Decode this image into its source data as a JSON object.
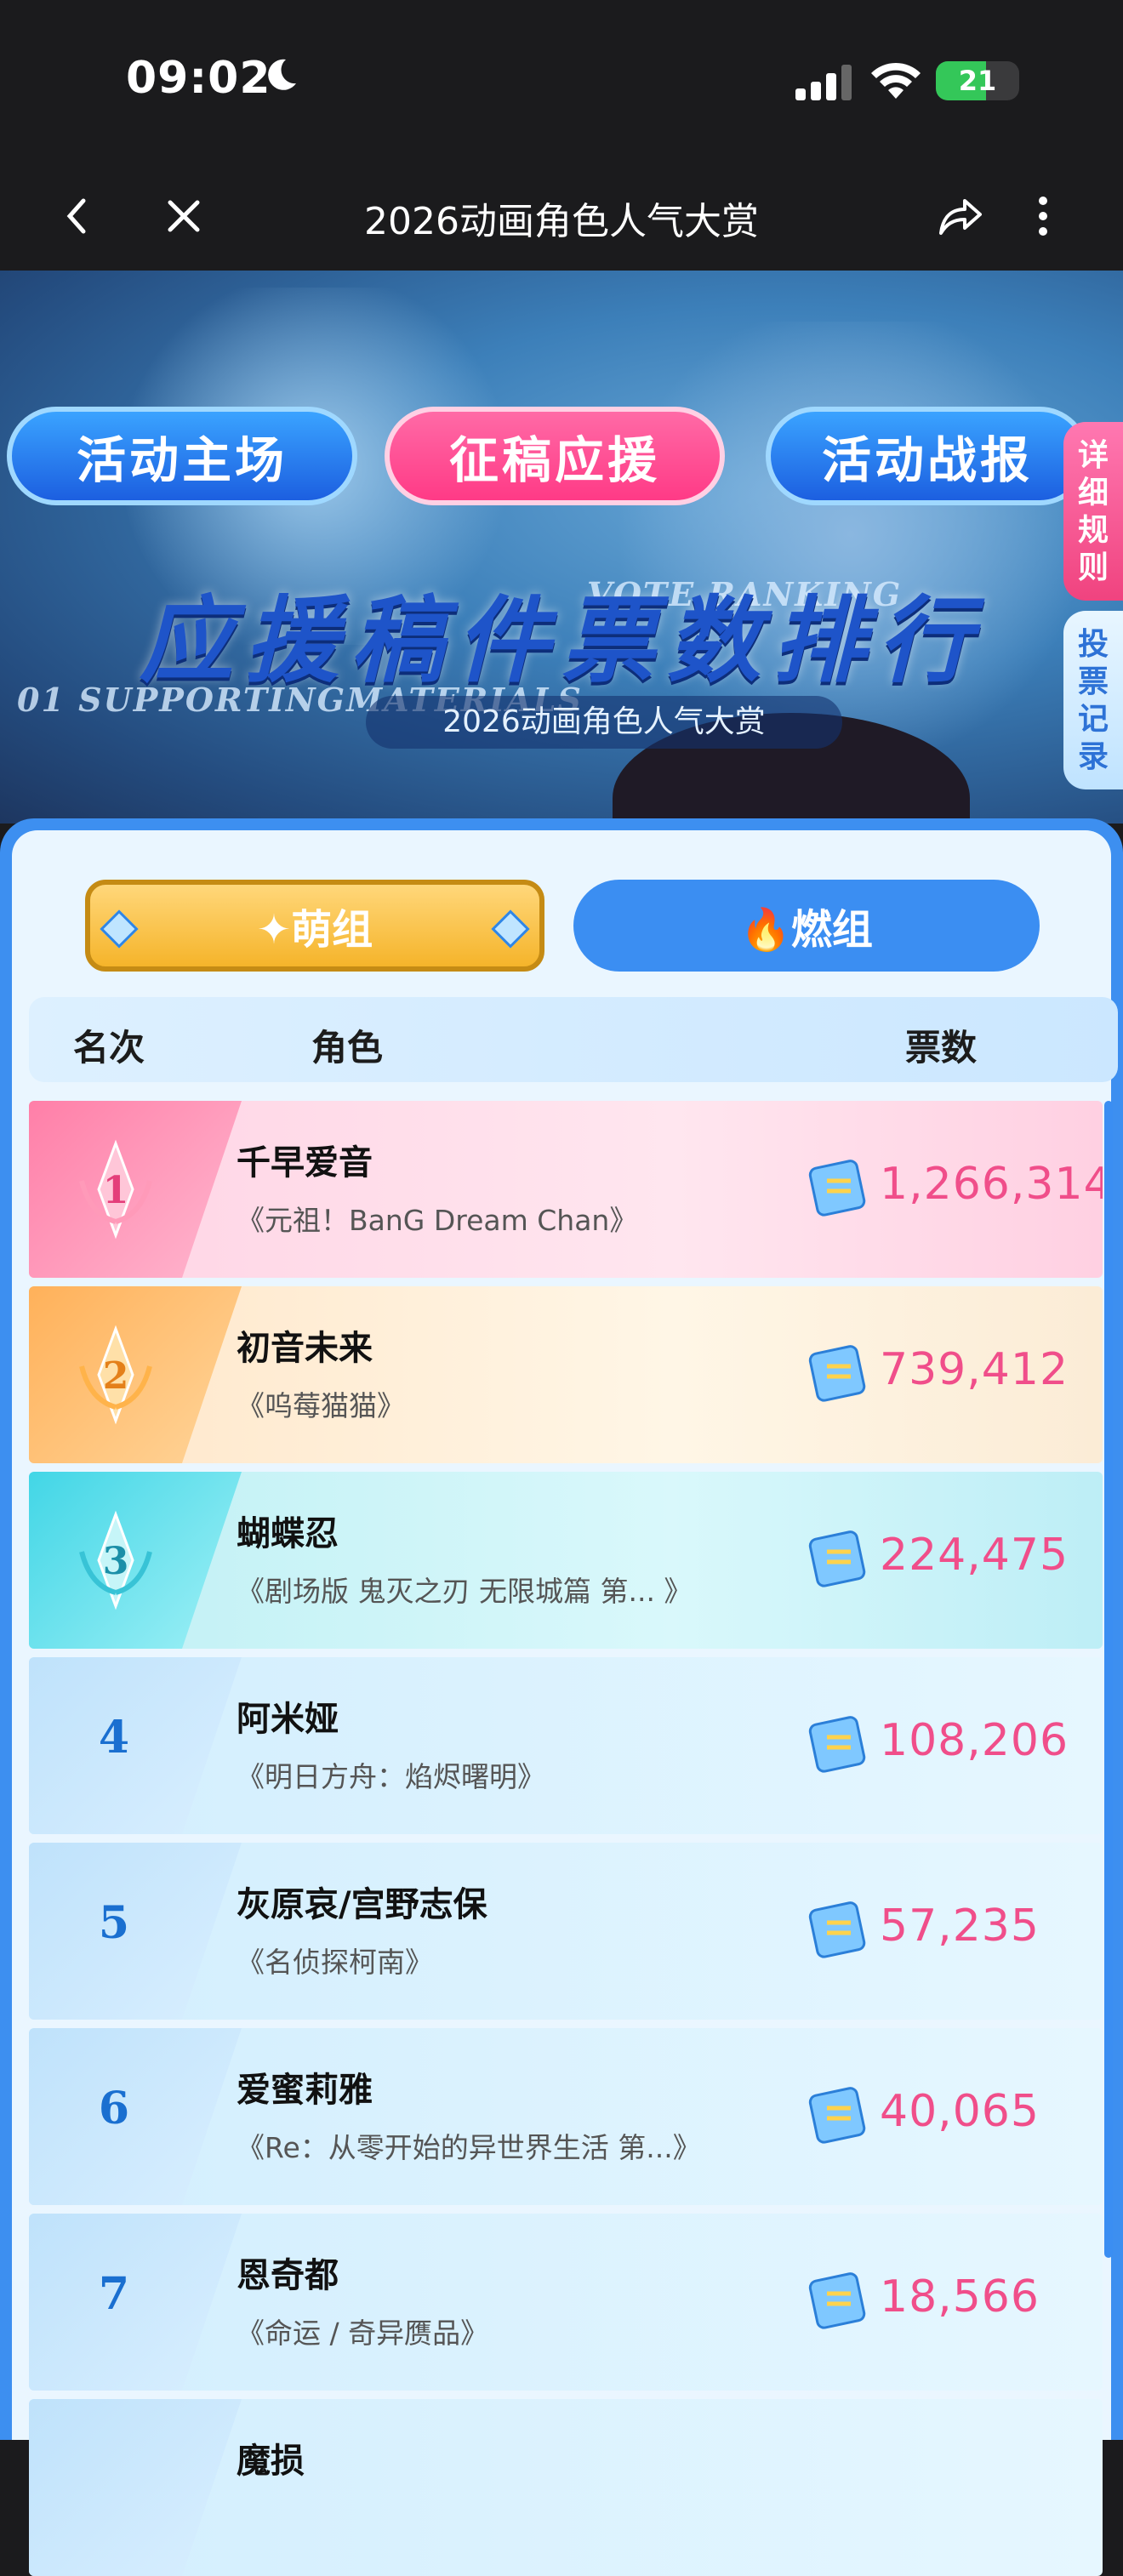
{
  "status_bar": {
    "time": "09:02",
    "battery": "21",
    "battery_level": 0.21
  },
  "nav": {
    "title": "2026动画角色人气大赏",
    "back_icon": "chevron-left-icon",
    "close_icon": "close-icon",
    "share_icon": "share-icon",
    "more_icon": "more-vertical-icon"
  },
  "hero": {
    "tabs": [
      "活动主场",
      "征稿应援",
      "活动战报"
    ],
    "active_tab": "征稿应援",
    "side_buttons": [
      "详细规则",
      "投票记录"
    ],
    "title": "应援稿件票数排行",
    "en_vote": "VOTE RANKING",
    "en_sub": "01 SUPPORTINGMATERIALS",
    "subtitle": "2026动画角色人气大赏"
  },
  "groups": {
    "meng": "✦萌组",
    "ran": "🔥燃组",
    "active": "萌组"
  },
  "table": {
    "headers": {
      "rank": "名次",
      "character": "角色",
      "votes": "票数"
    },
    "rows": [
      {
        "rank": "1",
        "name": "千早爱音",
        "work": "《元祖！BanG Dream Chan》",
        "votes": "1,266,314"
      },
      {
        "rank": "2",
        "name": "初音未来",
        "work": "《呜莓猫猫》",
        "votes": "739,412"
      },
      {
        "rank": "3",
        "name": "蝴蝶忍",
        "work": "《剧场版 鬼灭之刃 无限城篇 第... 》",
        "votes": "224,475"
      },
      {
        "rank": "4",
        "name": "阿米娅",
        "work": "《明日方舟：焰烬曙明》",
        "votes": "108,206"
      },
      {
        "rank": "5",
        "name": "灰原哀/宫野志保",
        "work": "《名侦探柯南》",
        "votes": "57,235"
      },
      {
        "rank": "6",
        "name": "爱蜜莉雅",
        "work": "《Re：从零开始的异世界生活 第...》",
        "votes": "40,065"
      },
      {
        "rank": "7",
        "name": "恩奇都",
        "work": "《命运 / 奇异赝品》",
        "votes": "18,566"
      },
      {
        "rank": "",
        "name": "魔损",
        "work": "",
        "votes": ""
      }
    ]
  },
  "colors": {
    "accent_blue": "#3b8ef2",
    "pink": "#f04e8a",
    "gold": "#f5b42a"
  }
}
